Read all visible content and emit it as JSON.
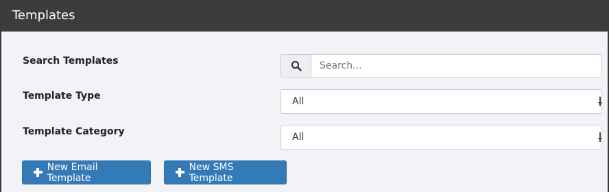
{
  "header": {
    "title": "Templates"
  },
  "form": {
    "search": {
      "label": "Search Templates",
      "placeholder": "Search...",
      "value": ""
    },
    "type": {
      "label": "Template Type",
      "selected": "All"
    },
    "category": {
      "label": "Template Category",
      "selected": "All"
    }
  },
  "actions": {
    "new_email_label": "New Email Template",
    "new_sms_label": "New SMS Template"
  },
  "icons": {
    "search": "search-icon",
    "plus": "plus-icon"
  },
  "colors": {
    "header_bg": "#3c3c3c",
    "primary": "#337ab7",
    "page_bg": "#f2f3f7"
  }
}
